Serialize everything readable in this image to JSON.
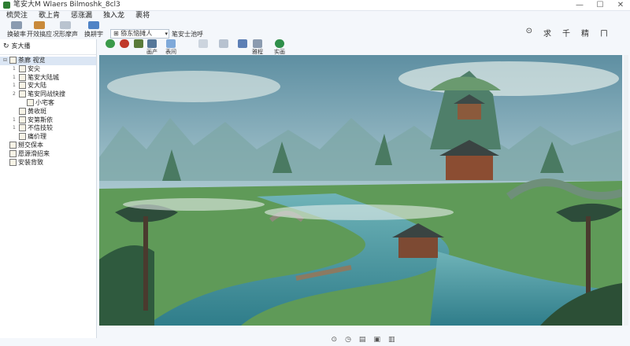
{
  "window": {
    "title": "笔安大M Wlaers Bilmoshk_8cl3",
    "min": "—",
    "max": "☐",
    "close": "✕"
  },
  "menu": [
    "梳荧注",
    "歌上肯",
    "惩涨漏",
    "独入龙",
    "裹将"
  ],
  "toolbar": [
    {
      "label": "换破率",
      "icon": "user-icon"
    },
    {
      "label": "开效搞应",
      "icon": "box-icon"
    },
    {
      "label": "况形摩声",
      "icon": "document-icon"
    },
    {
      "label": "换耕宇",
      "icon": "brush-icon"
    }
  ],
  "address": {
    "value": "⊞ 猕东恼摊人",
    "dropdown": "▾"
  },
  "address_side_label": "笔安士池呼",
  "right_links": [
    "⊙",
    "求",
    "千",
    "精",
    "ㄇ"
  ],
  "toolbar2": [
    {
      "label": "",
      "icon": "shield-icon"
    },
    {
      "label": "",
      "icon": "pin-icon"
    },
    {
      "label": "",
      "icon": "bottle-icon"
    },
    {
      "label": "画产",
      "icon": "monitor-icon"
    },
    {
      "label": "表间",
      "icon": "image-icon"
    },
    {
      "label": "",
      "icon": "page-icon"
    },
    {
      "label": "",
      "icon": "window-icon"
    },
    {
      "label": "",
      "icon": "wand-icon"
    },
    {
      "label": "雅程",
      "icon": "grid-icon"
    },
    {
      "label": "实画",
      "icon": "globe-icon"
    }
  ],
  "left_pane": {
    "header": "亥大播",
    "tree": [
      {
        "label": "茶廊 视览",
        "level": 0,
        "expand": "⊟",
        "selected": true
      },
      {
        "label": "安尖",
        "level": 1,
        "expand": "1"
      },
      {
        "label": "笔安大陆城",
        "level": 1,
        "expand": "1"
      },
      {
        "label": "安大陆",
        "level": 1,
        "expand": "1"
      },
      {
        "label": "笔安同战快搜",
        "level": 1,
        "expand": "2"
      },
      {
        "label": "小宅客",
        "level": 2,
        "expand": ""
      },
      {
        "label": "黄收斑",
        "level": 1,
        "expand": ""
      },
      {
        "label": "安第斯依",
        "level": 1,
        "expand": "1"
      },
      {
        "label": "不信技较",
        "level": 1,
        "expand": "1"
      },
      {
        "label": "痛价理",
        "level": 1,
        "expand": ""
      },
      {
        "label": "掰交保本",
        "level": 0,
        "expand": ""
      },
      {
        "label": "愿源滑招来",
        "level": 0,
        "expand": ""
      },
      {
        "label": "安装背致",
        "level": 0,
        "expand": ""
      }
    ]
  },
  "status_icons": [
    "⊙",
    "◷",
    "▤",
    "▣",
    "▥"
  ],
  "colors": {
    "accent": "#2e7d32",
    "selection": "#dbe6f4"
  }
}
